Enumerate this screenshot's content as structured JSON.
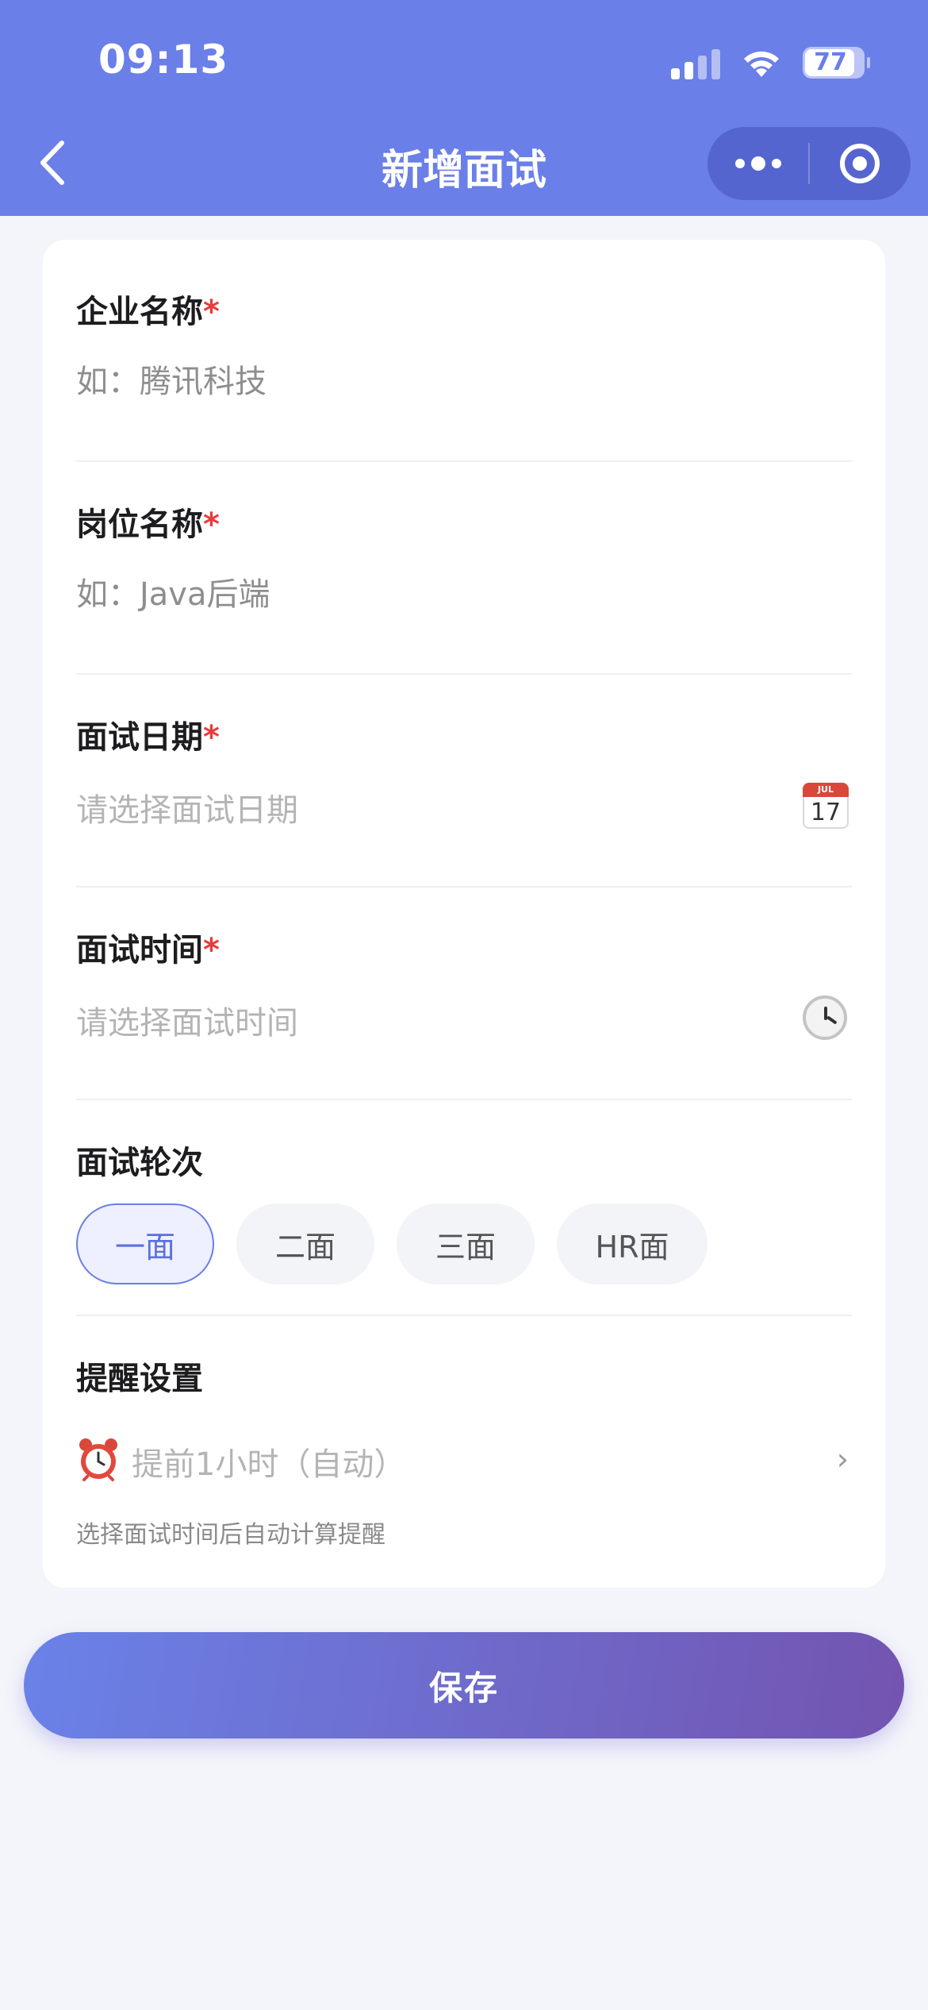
{
  "status_bar": {
    "time": "09:13",
    "battery": "77"
  },
  "nav": {
    "title": "新增面试"
  },
  "form": {
    "company": {
      "label": "企业名称",
      "required_mark": "*",
      "placeholder": "如：腾讯科技"
    },
    "position": {
      "label": "岗位名称",
      "required_mark": "*",
      "placeholder": "如：Java后端"
    },
    "date": {
      "label": "面试日期",
      "required_mark": "*",
      "placeholder": "请选择面试日期",
      "icon": "calendar-icon",
      "icon_day": "17",
      "icon_month": "JUL"
    },
    "time": {
      "label": "面试时间",
      "required_mark": "*",
      "placeholder": "请选择面试时间",
      "icon": "clock-icon"
    },
    "round": {
      "label": "面试轮次",
      "options": [
        "一面",
        "二面",
        "三面",
        "HR面"
      ],
      "selected": "一面"
    },
    "reminder": {
      "label": "提醒设置",
      "value": "提前1小时（自动）",
      "hint": "选择面试时间后自动计算提醒",
      "icon": "alarm-clock-icon"
    }
  },
  "actions": {
    "save_label": "保存"
  },
  "colors": {
    "primary": "#6a7fe8",
    "gradient_end": "#7354b0",
    "required": "#e83b3b",
    "background": "#f4f5fa"
  }
}
